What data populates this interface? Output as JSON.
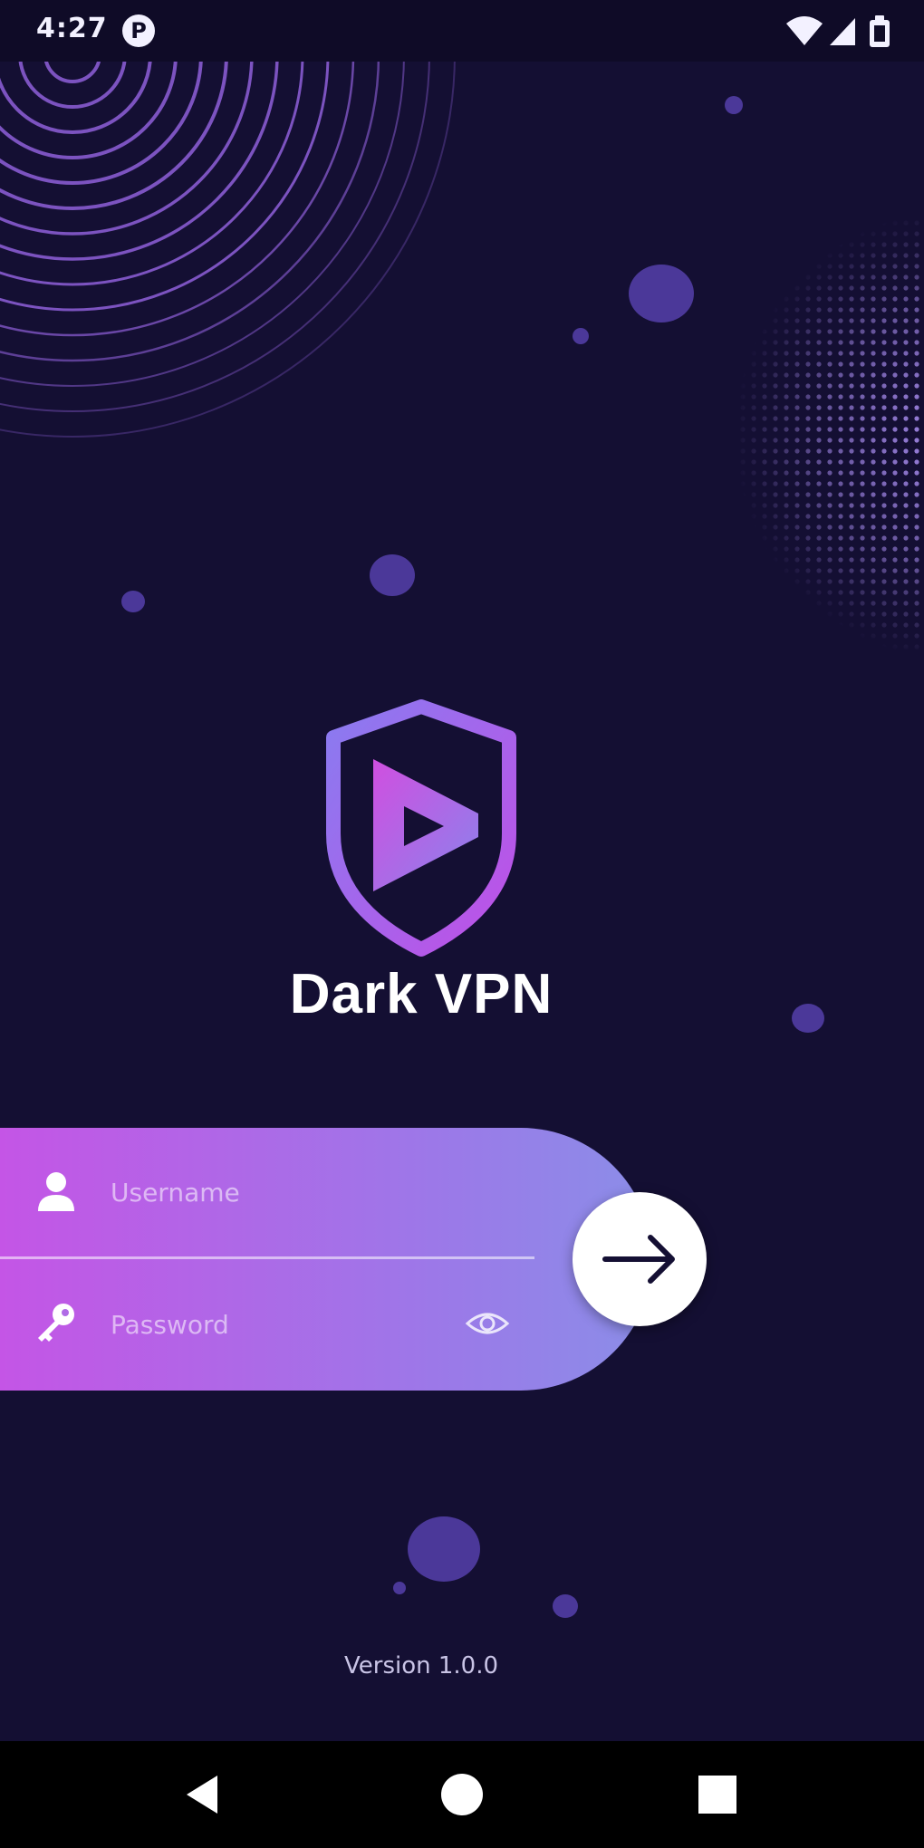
{
  "status_bar": {
    "time": "4:27",
    "app_icon_letter": "P"
  },
  "app": {
    "title": "Dark VPN",
    "version": "Version 1.0.0"
  },
  "login": {
    "username_placeholder": "Username",
    "password_placeholder": "Password"
  },
  "colors": {
    "background": "#140f33",
    "accent_pink": "#c455e6",
    "accent_lavender": "#8b8ee8"
  },
  "icons": {
    "username": "user-icon",
    "password": "key-icon",
    "visibility": "eye-icon",
    "submit": "arrow-right-icon",
    "nav_back": "back-triangle-icon",
    "nav_home": "home-circle-icon",
    "nav_recents": "recents-square-icon"
  }
}
